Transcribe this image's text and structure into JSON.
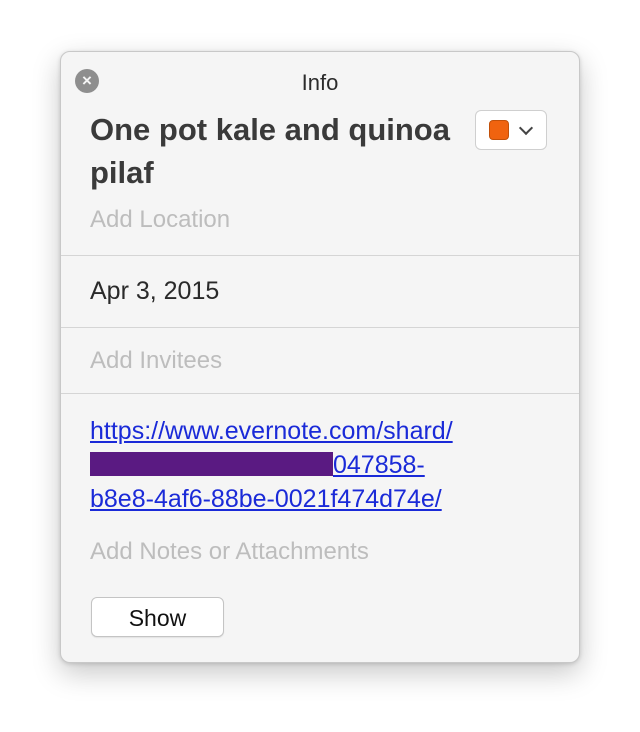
{
  "panel": {
    "title": "Info"
  },
  "event": {
    "title": "One pot kale and quinoa pilaf",
    "color": "#f0630f",
    "location_placeholder": "Add Location",
    "date": "Apr 3, 2015",
    "invitees_placeholder": "Add Invitees",
    "url_line1": "https://www.evernote.com/shard/",
    "url_line2_visible": "047858-",
    "url_line3": "b8e8-4af6-88be-0021f474d74e/",
    "notes_placeholder": "Add Notes or Attachments"
  },
  "actions": {
    "show_label": "Show"
  },
  "icons": {
    "close": "close-icon",
    "chevron": "chevron-down-icon"
  }
}
